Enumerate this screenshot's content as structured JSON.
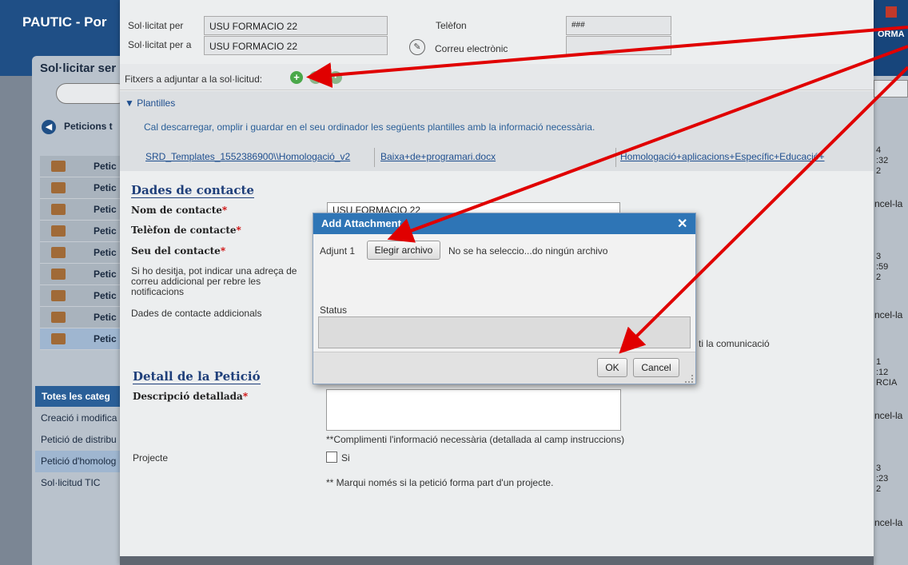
{
  "background": {
    "brand": "PAUTIC - Por",
    "panel_title": "Sol·licitar ser",
    "back_label": "Peticions t",
    "rows": [
      "Petic",
      "Petic",
      "Petic",
      "Petic",
      "Petic",
      "Petic",
      "Petic",
      "Petic",
      "Petic"
    ],
    "categories_header": "Totes les categ",
    "categories": [
      "Creació i modifica",
      "Petició de distribu",
      "Petició d'homolog",
      "Sol·licitud TIC"
    ],
    "right_tab": "ORMA",
    "right_values": [
      {
        "lines": [
          "4",
          ":32",
          "2"
        ],
        "cancel": "ncel-la"
      },
      {
        "lines": [
          "3",
          ":59",
          "2"
        ],
        "cancel": "ncel-la"
      },
      {
        "lines": [
          "1",
          ":12",
          "RCIA"
        ],
        "cancel": "ncel-la"
      },
      {
        "lines": [
          "3",
          ":23",
          "2"
        ],
        "cancel": "ncel-la"
      }
    ]
  },
  "form": {
    "requested_by_label": "Sol·licitat per",
    "requested_by_value": "USU FORMACIO 22",
    "requested_for_label": "Sol·licitat per a",
    "requested_for_value": "USU FORMACIO 22",
    "phone_label": "Telèfon",
    "phone_value": "###",
    "email_label": "Correu electrònic",
    "email_value": "",
    "attach_label": "Fitxers a adjuntar a la sol·licitud:",
    "templates_toggle": "▼  Plantilles",
    "templates_note": "Cal descarregar, omplir i guardar en el seu ordinador les següents plantilles amb la informació necessària.",
    "template_links": [
      "SRD_Templates_1552386900\\\\Homologació_v2",
      "Baixa+de+programari.docx",
      "Homologació+aplicacions+Específic+Educació+"
    ],
    "contact_section": "Dades de contacte",
    "contact_name_label": "Nom de contacte",
    "contact_name_value": "USU FORMACIO 22",
    "contact_phone_label": "Telèfon de contacte",
    "contact_site_label": "Seu del contacte",
    "required_mark": "*",
    "extra_email_note": "Si ho desitja, pot indicar una adreça de correu addicional per rebre les notificacions",
    "extra_contact_label": "Dades de contacte addicionals",
    "comm_tail": "ti la comunicació",
    "detail_section": "Detall de la Petició",
    "detail_desc_label": "Descripció detallada",
    "detail_hint": "**Complimenti l'informació necessària (detallada al camp instruccions)",
    "project_label": "Projecte",
    "project_checkbox_label": "Si",
    "project_hint": "** Marqui només si la petició forma part d'un projecte."
  },
  "modal": {
    "title": "Add Attachment",
    "close": "✕",
    "file_label": "Adjunt 1",
    "choose_button": "Elegir archivo",
    "no_file": "No se ha seleccio...do ningún archivo",
    "status_label": "Status",
    "ok": "OK",
    "cancel": "Cancel"
  },
  "colors": {
    "header_blue": "#1f4f86",
    "modal_blue": "#2e75b6",
    "section_blue": "#1f3f7a",
    "arrow_red": "#e00000",
    "add_green": "#4aa84a"
  }
}
